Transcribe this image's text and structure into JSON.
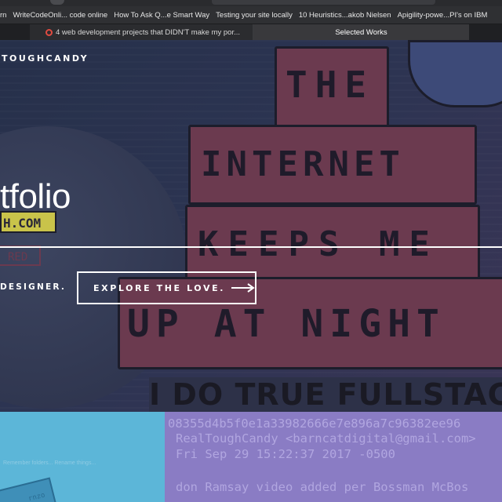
{
  "bookmarks": [
    "rn",
    "WriteCodeOnli... code online",
    "How To Ask Q...e Smart Way",
    "Testing your site locally",
    "10 Heuristics...akob Nielsen",
    "Apigility-powe...PI's on IBM"
  ],
  "tabs": [
    {
      "title": "4 web development projects that DIDN'T make my por..."
    },
    {
      "title": "Selected Works"
    }
  ],
  "hero": {
    "brand": "TOUGHCANDY",
    "title": "tfolio",
    "subtitle": "DESIGNER.",
    "cta_label": "EXPLORE THE LOVE."
  },
  "hero_image": {
    "sticker_the": "THE",
    "sticker_internet": "INTERNET",
    "sticker_keeps": "KEEPS ME",
    "sticker_night": "UP AT NIGHT",
    "banner": "I DO TRUE FULLSTACK",
    "left_sticker_1": "H.COM",
    "left_sticker_2": "RED"
  },
  "tiles": {
    "left": {
      "caption": "Remember folders... Rename things...",
      "card_label": "rnzo"
    },
    "right": {
      "commit_hash": "08355d4b5f0e1a33982666e7e896a7c96382ee96",
      "commit_author": "RealToughCandy <barncatdigital@gmail.com>",
      "commit_date": "Fri Sep 29 15:22:37 2017 -0500",
      "commit_message": "don Ramsay video added per Bossman McBos"
    }
  },
  "colors": {
    "hero_bg": "#2c3452",
    "sticker": "#6b3a4f",
    "tile_left": "#5cb6d8",
    "tile_right": "#8a7cc4",
    "text_white": "#ffffff"
  }
}
